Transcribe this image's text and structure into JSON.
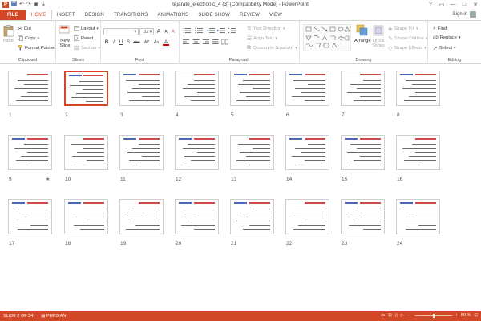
{
  "window": {
    "title": "tejarate_electronic_4 (3) [Compatibility Mode] - PowerPoint",
    "sign_in": "Sign in",
    "controls": [
      "?",
      "▭",
      "—",
      "□",
      "✕"
    ]
  },
  "qat": {
    "undo": "↶",
    "redo": "↷",
    "start": "▣",
    "more": "⇣"
  },
  "tabs": [
    "FILE",
    "HOME",
    "INSERT",
    "DESIGN",
    "TRANSITIONS",
    "ANIMATIONS",
    "SLIDE SHOW",
    "REVIEW",
    "VIEW"
  ],
  "active_tab": "HOME",
  "ribbon": {
    "clipboard": {
      "label": "Clipboard",
      "paste": "Paste",
      "cut": "Cut",
      "copy": "Copy",
      "format_painter": "Format Painter"
    },
    "slides": {
      "label": "Slides",
      "new_slide": "New",
      "new_slide2": "Slide",
      "layout": "Layout",
      "reset": "Reset",
      "section": "Section"
    },
    "font": {
      "label": "Font",
      "font_size": "32",
      "bold": "B",
      "italic": "I",
      "underline": "U",
      "shadow": "S",
      "strike": "abc",
      "spacing": "AV",
      "case": "Aa",
      "color": "A",
      "grow": "A",
      "shrink": "A",
      "clear": "A"
    },
    "paragraph": {
      "label": "Paragraph",
      "text_direction": "Text Direction",
      "align_text": "Align Text",
      "smartart": "Convert to SmartArt"
    },
    "drawing": {
      "label": "Drawing",
      "arrange": "Arrange",
      "quick_styles": "Quick",
      "quick_styles2": "Styles",
      "shape_fill": "Shape Fill",
      "shape_outline": "Shape Outline",
      "shape_effects": "Shape Effects"
    },
    "editing": {
      "label": "Editing",
      "find": "Find",
      "replace": "Replace",
      "select": "Select"
    }
  },
  "slides": [
    {
      "num": "1"
    },
    {
      "num": "2"
    },
    {
      "num": "3"
    },
    {
      "num": "4"
    },
    {
      "num": "5"
    },
    {
      "num": "6"
    },
    {
      "num": "7"
    },
    {
      "num": "8"
    },
    {
      "num": "9",
      "star": "★"
    },
    {
      "num": "10"
    },
    {
      "num": "11"
    },
    {
      "num": "12"
    },
    {
      "num": "13"
    },
    {
      "num": "14"
    },
    {
      "num": "15"
    },
    {
      "num": "16"
    },
    {
      "num": "17"
    },
    {
      "num": "18"
    },
    {
      "num": "19"
    },
    {
      "num": "20"
    },
    {
      "num": "21"
    },
    {
      "num": "22"
    },
    {
      "num": "23"
    },
    {
      "num": "24"
    }
  ],
  "selected_slide": "2",
  "status": {
    "slide_of": "SLIDE 2 OF 24",
    "language": "PERSIAN",
    "zoom": "50 %",
    "zoom_out": "—",
    "zoom_in": "+",
    "zoom_fraction": 0.5
  },
  "colors": {
    "accent": "#d24726",
    "status_bg": "#d24726"
  }
}
